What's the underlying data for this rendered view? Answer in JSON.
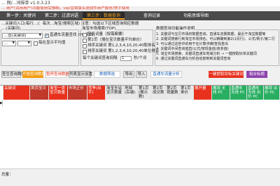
{
  "window": {
    "title": "... 网/...词报单 v1.0.3.23"
  },
  "notice": "... 商户(试用用户)功能使用受限制，vip/营销版买送软件商户服务/快手使用",
  "tabs": [
    "第一步：关键词",
    "第二步：过滤词语",
    "第三步：数据查询",
    "查询记录",
    "功能思维导图"
  ],
  "active_tab": 2,
  "hint": "...关键词入口(每行...)：每次...淘宝/搜索区域) 注意：勾选以下区域查询相应数据",
  "left_panel": {
    "title": "...(关键词)",
    "select1": "...查(关键词)",
    "checkbox_label": "直通车流量查找 (PC/无线)",
    "checkbox_checked": true,
    "row2_prefix": "...",
    "radio_label": "每在显示平均值"
  },
  "mid_panel": {
    "title": "淘宝市场搜索(TOP)",
    "items": [
      {
        "label": "宝贝词量（按需都要）",
        "checked": false
      },
      {
        "label": "第2页（搜在宝贝数量平均单价）",
        "checked": false
      },
      {
        "label": "排序关键词 第1,2,3,4,10,20,40取排名",
        "checked": false
      },
      {
        "label": "排序关键词 第1,2,3,4,10,20,40单位排名",
        "checked": false
      }
    ],
    "interval_label": "每个关键词查询间隔",
    "interval_unit": "秒/个词",
    "interval_value": "1"
  },
  "right_panel": {
    "title": "数据查询功能操作说明",
    "lines": [
      "1. 关键词与宝贝市场的数据查询，直通车流量数据，最近于淘宝数据等",
      "2. 关键词搜索行到淘宝市场排名，可以精确到第2(1页行)、公式/例子/第二行",
      "3. 可以通过这些中的用于在计算/判断查找查出",
      "4. 关键词中间查询值直/公式/按现金值(商务值)",
      "5. 淘宝市场搜索，关键词直通车地域分析 → 一键搜取好单关键词",
      "6. 通过关键词直通车分析自动复制到关键词查询"
    ]
  },
  "buttons": {
    "start": "开始查询数据",
    "stop": "暂停查询数据",
    "clear": "查生查询数据",
    "list": "列表显示设置",
    "filter": "数据筛选",
    "export": "导出",
    "import": "导入",
    "direct": "直通车流量分析",
    "onekey": "一键提取目标关键词",
    "merge": "组合标题"
  },
  "stats": {
    "total": "总量",
    "per": "个"
  },
  "columns": [
    "",
    "关键词",
    "首页宝贝",
    "淘宝一类宝贝数量",
    "市场正价",
    "竞争(出手)",
    "淘宝全站 宝贝数量",
    "地域(后端)",
    "第1页(展示数)",
    "第2页 成交数",
    "第2页 销量数",
    "第1页 单价",
    "展开量",
    "展现 无线 PC",
    "直通车 无线 PC",
    "直通车 无线 出价 PC",
    "展现 出价 PC"
  ],
  "footer": {
    "label": "总量："
  },
  "colors": {
    "accent": "#f0a020",
    "brand_red": "#e8321e",
    "green": "#27ae60",
    "orange": "#f39c12",
    "purple": "#8e44ad"
  }
}
